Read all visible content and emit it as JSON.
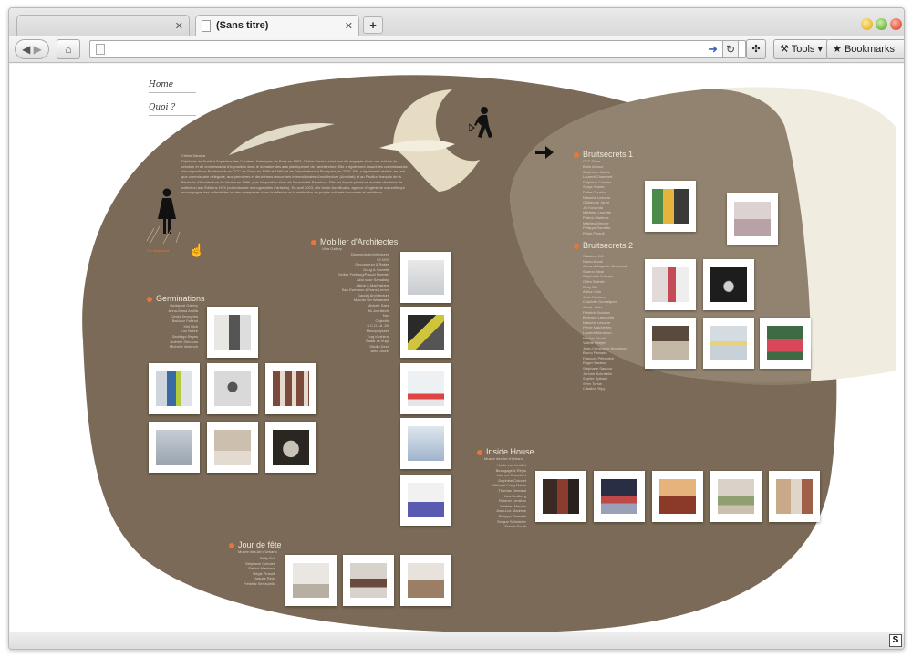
{
  "browser": {
    "tabs": [
      {
        "label": ""
      },
      {
        "label": "(Sans titre)"
      }
    ],
    "new_tab_label": "+",
    "tools_label": "Tools",
    "bookmarks_label": "Bookmarks",
    "url": ""
  },
  "page": {
    "menu": {
      "home": "Home",
      "quoi": "Quoi ?"
    },
    "bio_caption": "Céline Saraiva",
    "bio": "Diplômée de l'Institut Supérieur des Carrières Artistiques de Paris en 1993, Céline Saraiva s'est ensuite engagée dans une activité de création et de commissariat d'exposition dans le domaine des arts plastiques et de l'architecture. Elle a également assuré les commissariats des expositions Bruitsecrets au CCC de Tours en 1998 et 1999, et de Germinations à Budapest, en 2005. Elle a également réalisé, en tant que commissaire déléguée, aux premières et deuxièmes rencontres internationales d'architecture (Archilab) et au Pavillon français de la Biennale d'Architecture de Venise en 1996, puis l'exposition Hors de l'immobilité Paradoxe. Elle est depuis plusieurs années directrice de collection aux Éditions HYX (collection de monographies d'artistes). En avril 2003, elle fonde Amplitudes, agence d'ingénierie culturelle qui accompagne des collectivités ou des entreprises dans la réflexion et la réalisation de projets culturels innovants et ambitieux.",
    "download": "CV download",
    "sections": {
      "germinations": {
        "title": "Germinations",
        "subtitle": "Budapest Gallery",
        "names": "Anna-Maria Amilla\nCécile Deroghes\nBalduzz Fallinot\nKiel Moh\nLuc Nobre\nSantiago Reyes\nNoémie Simoons\nMichelle Wakinch"
      },
      "mobilier": {
        "title": "Mobilier d'Architectes",
        "subtitle": "Vitra Gallery",
        "names": "Diamonds Architectures\n53 NYE\nDeconstruct & Rakes\nDoug & Gunette\nSeiber Freiburg/Pascal Normier\nAldo vase Samalsky\nJakob & MacFarlane\nBas Ewenson & Hans Lemon\nGaudaj Architecture\nMakoto Sei Watanabe\nMichele Saee\nNL Architects\nNox\nObjectile\nS.C.O.I.A. DE\nMesopolysses\nTorg Kushima\nSadar vs Vuga\nStudio Desh\nBeta Jouret"
      },
      "bruit1": {
        "title": "Bruitsecrets 1",
        "subtitle": "CCC Tours",
        "names": "Boris Achour\nStéphane Calais\nLaurent Chambert\nDelphine Coindet\nSerge Comte\nDidier Courbot\nNatacha Lesueur\nGuillaume Janot\nJiri Kovanda\nMatthieu Laurette\nPatrick Martinez\nMathieu Mercier\nPhilippe Ramette\nRégis Pinault"
      },
      "bruit2": {
        "title": "Bruitsecrets 2",
        "subtitle": "",
        "names": "Saâdane Afif\nNaoto Anzai\nArmand Augustin Darmand\nSharon Bleal\nStéphanie Schraer\nGilles Barbier\nBetty Bui\nArthur Cols\nAlain Declercq\nCharlotte Dumalquer\nAlexis Janiz\nFrédéric Noirdan\nBertrand Lamarche\nNatacha Lesueur\nPierre Malphettes\nLaurent Montaron\nNicolas Moulin\nValérie Mréjen\nJean-Christophe Nourisson\nBruno Peinado\nFrançois Pétrovitch\nRoger Saraiva\nStéphane Sautour\nJérôme Schneblin\nSophie Spitarci\nSven Tornw\nCatalina Ylipy"
      },
      "inside": {
        "title": "Inside House",
        "subtitle": "Musée des Art d'Urbano",
        "names": "Hedie von Lindtiel\nBeaugage & Réjus\nLaurent Chambert\nDelphine Coindet\nMichael Craig Martin\nThomas Demand\nLiza Lindberg\nRaimon Lemieux\nMathieu Mercier\nJean-Luc Moulène\nPhilippe Ramette\nSergue Schneider\nFranck Scurti"
      },
      "jour": {
        "title": "Jour de fête",
        "subtitle": "Musée des Art d'Urbano",
        "names": "Betty Bui\nStéphane Coindet\nPatrick Martinez\nRégis Pinault\nHugues Reip\nFrédéric Serrau/elk"
      }
    }
  },
  "colors": {
    "blob": "#7a6a57",
    "blob_light": "#f1ece0",
    "accent": "#e8763a",
    "text_light": "#d8cfbf"
  },
  "icons": [
    "home-icon",
    "back-icon",
    "forward-icon",
    "reload-icon",
    "tools-icon",
    "bookmarks-icon",
    "man-walking-icon",
    "woman-icon",
    "hand-cursor-icon",
    "arrow-right-icon"
  ]
}
